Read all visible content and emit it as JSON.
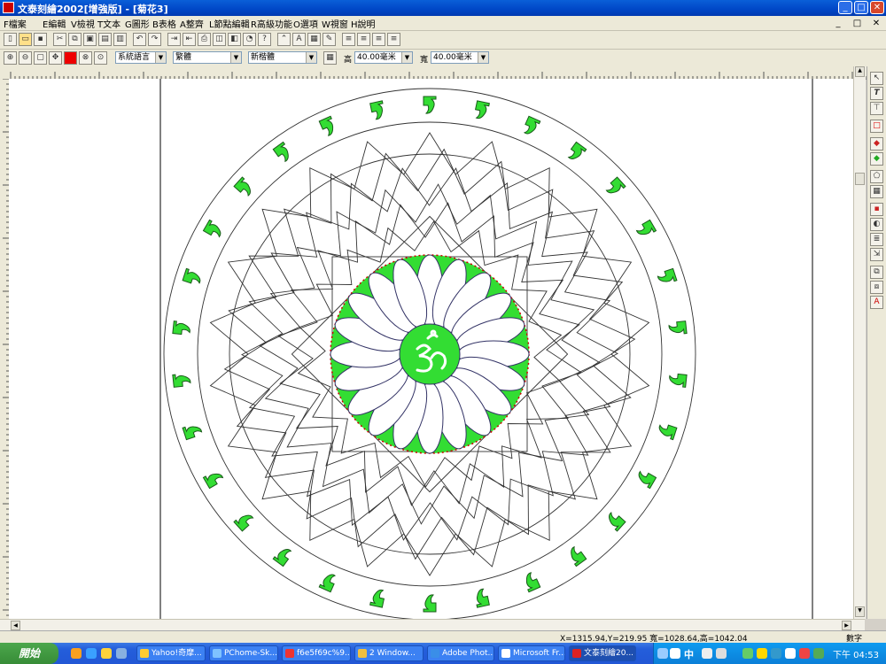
{
  "window": {
    "title": "文泰刻繪2002[增強版] - [菊花3]",
    "minimize_glyph": "_",
    "maximize_glyph": "□",
    "close_glyph": "✕"
  },
  "menu": {
    "items": [
      "F檔案",
      "E編輯",
      "V檢視",
      "T文本",
      "G圖形",
      "B表格",
      "A整齊",
      "L節點編輯",
      "R高級功能",
      "O選項",
      "W視窗",
      "H說明"
    ]
  },
  "format_bar": {
    "language": "系統語言",
    "font1": "繁體",
    "font2": "新楷體",
    "height_label": "高",
    "height_value": "40.00毫米",
    "width_label": "寬",
    "width_value": "40.00毫米"
  },
  "status": {
    "coords": "X=1315.94,Y=219.95 寬=1028.64,高=1042.04",
    "mode": "數字"
  },
  "taskbar": {
    "start_label": "開始",
    "tasks": [
      "Yahoo!奇摩...",
      "PChome-Sk...",
      "f6e5f69c%9...",
      "2 Window...",
      "Adobe Phot...",
      "Microsoft Fr...",
      "文泰刻繪20..."
    ],
    "ime": "中",
    "clock": "下午 04:53"
  },
  "colors": {
    "titlebar": "#0a5fd8",
    "mantra_green": "#33dd33",
    "outline": "#333333",
    "center_red_dots": "#cc0000"
  },
  "icons": [
    "app-icon",
    "new-icon",
    "open-icon",
    "save-icon",
    "cut-icon",
    "copy-icon",
    "paste-icon",
    "undo-icon",
    "redo-icon",
    "print-icon",
    "zoom-in-icon",
    "zoom-out-icon",
    "move-icon",
    "pointer-icon",
    "text-icon",
    "start-flag-icon"
  ]
}
